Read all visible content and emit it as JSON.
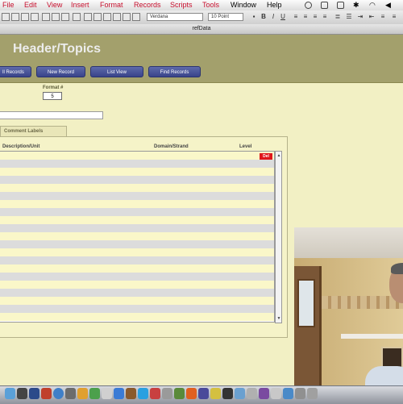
{
  "menubar": {
    "items": [
      "File",
      "Edit",
      "View",
      "Insert",
      "Format",
      "Records",
      "Scripts",
      "Tools",
      "Window",
      "Help"
    ]
  },
  "toolbar": {
    "font": "Verdana",
    "size": "10 Point"
  },
  "window": {
    "title": "refData"
  },
  "header": {
    "title": "Header/Topics"
  },
  "nav_buttons": [
    "ll Records",
    "New Record",
    "List View",
    "Find Records"
  ],
  "format": {
    "label": "Format #",
    "value": "5"
  },
  "tab": {
    "label": "Comment Labels"
  },
  "portal": {
    "columns": [
      "Description/Unit",
      "Domain/Strand",
      "Level"
    ],
    "delete_label": "Del"
  },
  "colors": {
    "header_bg": "#a3a06c",
    "button_blue": "#4a56a0",
    "delete_red": "#e0161b",
    "row_gray": "#dcdcdc",
    "row_yellow": "#faf7c9"
  }
}
